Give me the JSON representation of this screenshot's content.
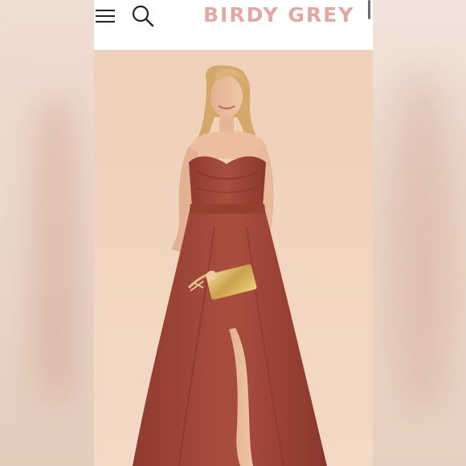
{
  "header": {
    "brand": "BIRDY GREY",
    "menu_icon": "hamburger-menu-icon",
    "search_icon": "search-icon"
  },
  "product_image": {
    "subject": "model-in-strapless-dress",
    "dress_color": "#a2483a",
    "background_color": "#f0d4bd"
  },
  "colors": {
    "brand_pink": "#e3a8a3",
    "dress_rust": "#a2483a",
    "backdrop_peach": "#f0d4bd"
  }
}
